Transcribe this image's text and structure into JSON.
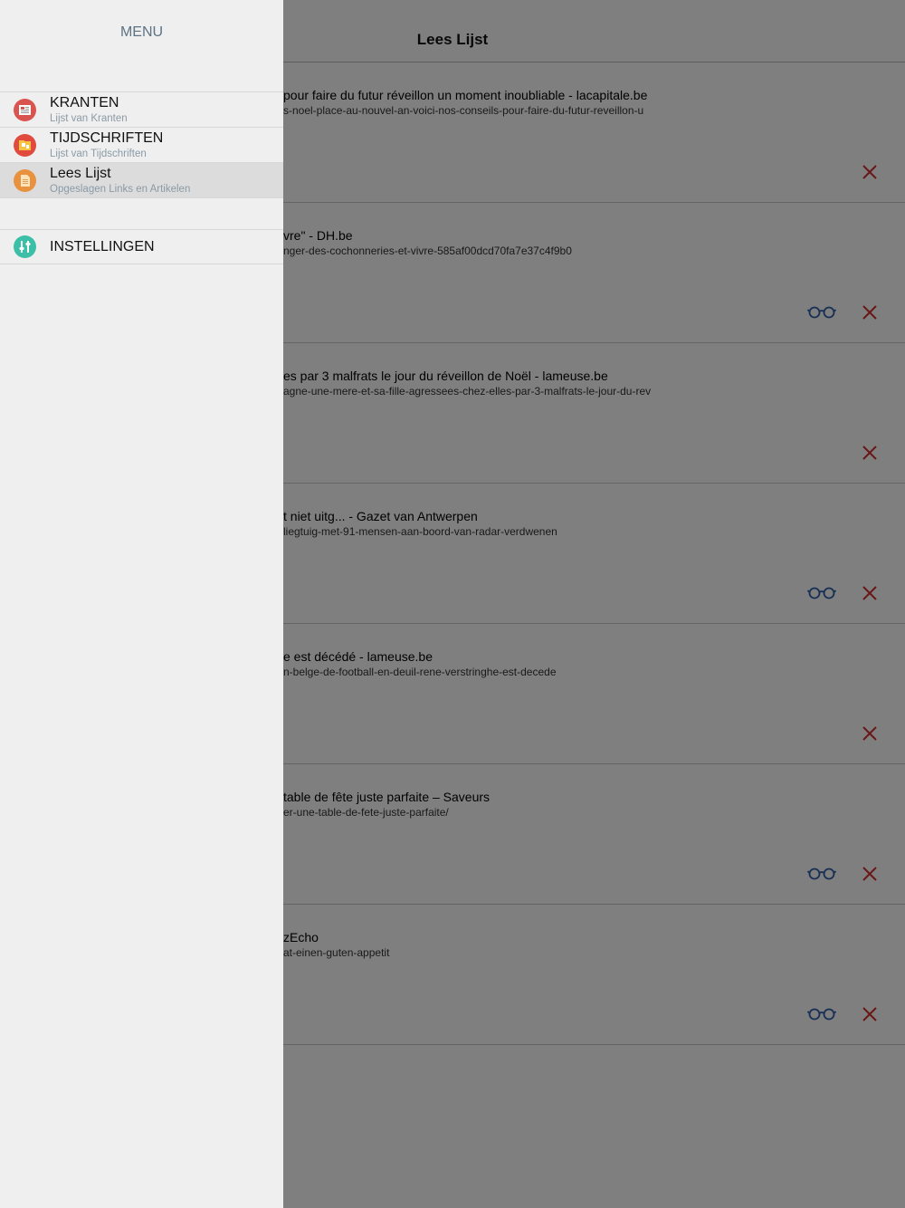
{
  "navbar": {
    "title": "Lees Lijst"
  },
  "articles": [
    {
      "title": "pour faire du futur réveillon un moment inoubliable - lacapitale.be",
      "url": "s-noel-place-au-nouvel-an-voici-nos-conseils-pour-faire-du-futur-reveillon-u",
      "has_read": false
    },
    {
      "title": "vre\" - DH.be",
      "url": "nger-des-cochonneries-et-vivre-585af00dcd70fa7e37c4f9b0",
      "has_read": true
    },
    {
      "title": "es par 3 malfrats le jour du réveillon de Noël - lameuse.be",
      "url": "agne-une-mere-et-sa-fille-agressees-chez-elles-par-3-malfrats-le-jour-du-rev",
      "has_read": false
    },
    {
      "title": "t niet uitg... - Gazet van Antwerpen",
      "url": "liegtuig-met-91-mensen-aan-boord-van-radar-verdwenen",
      "has_read": true
    },
    {
      "title": "e est décédé - lameuse.be",
      "url": "n-belge-de-football-en-deuil-rene-verstringhe-est-decede",
      "has_read": false
    },
    {
      "title": "table de fête juste parfaite – Saveurs",
      "url": "er-une-table-de-fete-juste-parfaite/",
      "has_read": true
    },
    {
      "title": "zEcho",
      "url": "at-einen-guten-appetit",
      "has_read": true
    }
  ],
  "icons": {
    "read": "glasses-icon",
    "delete": "close-icon"
  },
  "colors": {
    "read": "#2e5fa8",
    "delete": "#d32f2f",
    "menu_title": "#5d7384"
  },
  "menu": {
    "title": "MENU",
    "items": [
      {
        "label": "KRANTEN",
        "sublabel": "Lijst van Kranten",
        "icon": "newspaper-icon",
        "color": "#d9534f",
        "selected": false
      },
      {
        "label": "TIJDSCHRIFTEN",
        "sublabel": "Lijst van Tijdschriften",
        "icon": "magazine-icon",
        "color": "#e04a3f",
        "selected": false
      },
      {
        "label": "Lees Lijst",
        "sublabel": "Opgeslagen Links en Artikelen",
        "icon": "document-icon",
        "color": "#e8913f",
        "selected": true
      }
    ],
    "settings": {
      "label": "INSTELLINGEN",
      "icon": "settings-sliders-icon",
      "color": "#3bbfa6"
    }
  }
}
